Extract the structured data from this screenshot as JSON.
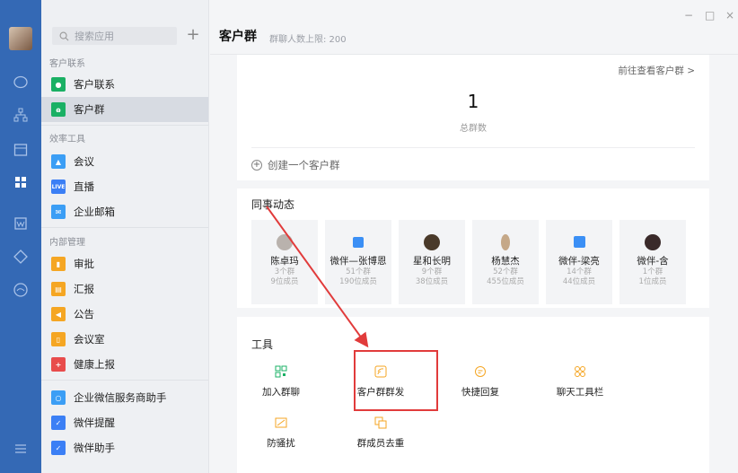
{
  "sidebar": {
    "search_placeholder": "搜索应用",
    "plus": "+",
    "sections": [
      "客户联系",
      "效率工具",
      "内部管理"
    ],
    "items": [
      {
        "label": "客户联系",
        "color": "#1ab064",
        "icon": "chat-icon"
      },
      {
        "label": "客户群",
        "color": "#1ab064",
        "icon": "group-icon"
      },
      {
        "label": "会议",
        "color": "#3b9ef5",
        "icon": "meeting-icon"
      },
      {
        "label": "直播",
        "color": "#3b7ff5",
        "icon": "live-icon",
        "badge": "LIVE"
      },
      {
        "label": "企业邮箱",
        "color": "#3b9ef5",
        "icon": "mail-icon"
      },
      {
        "label": "审批",
        "color": "#f5a623",
        "icon": "approval-icon"
      },
      {
        "label": "汇报",
        "color": "#f5a623",
        "icon": "report-icon"
      },
      {
        "label": "公告",
        "color": "#f5a623",
        "icon": "announcement-icon"
      },
      {
        "label": "会议室",
        "color": "#f5a623",
        "icon": "meeting-room-icon"
      },
      {
        "label": "健康上报",
        "color": "#e84c4c",
        "icon": "health-icon"
      },
      {
        "label": "企业微信服务商助手",
        "color": "#3b9ef5",
        "icon": "service-icon"
      },
      {
        "label": "微伴提醒",
        "color": "#3b7ff5",
        "icon": "remind-icon"
      },
      {
        "label": "微伴助手",
        "color": "#3b7ff5",
        "icon": "assistant-icon"
      }
    ]
  },
  "header": {
    "title": "客户群",
    "subtitle": "群聊人数上限: 200"
  },
  "summary": {
    "goto": "前往查看客户群 >",
    "count": "1",
    "count_label": "总群数",
    "create": "创建一个客户群"
  },
  "colleagues": {
    "title": "同事动态",
    "people": [
      {
        "name": "陈卓玛",
        "groups": "3个群",
        "members": "9位成员",
        "avatar_color": "#b9b2ad"
      },
      {
        "name": "微伴—张博恩",
        "groups": "51个群",
        "members": "190位成员",
        "avatar_color": "#3b8ff5"
      },
      {
        "name": "星和长明",
        "groups": "9个群",
        "members": "38位成员",
        "avatar_color": "#4a3a2a"
      },
      {
        "name": "杨慧杰",
        "groups": "52个群",
        "members": "455位成员",
        "avatar_color": "#c5a888"
      },
      {
        "name": "微伴-梁亮",
        "groups": "14个群",
        "members": "44位成员",
        "avatar_color": "#3b8ff5"
      },
      {
        "name": "微伴-含",
        "groups": "1个群",
        "members": "1位成员",
        "avatar_color": "#3a2a2a"
      }
    ]
  },
  "tools": {
    "title": "工具",
    "items": [
      {
        "label": "加入群聊",
        "icon": "qr-code-icon",
        "color": "#1ab064"
      },
      {
        "label": "客户群群发",
        "icon": "broadcast-icon",
        "color": "#f5a623"
      },
      {
        "label": "快捷回复",
        "icon": "quick-reply-icon",
        "color": "#f5a623"
      },
      {
        "label": "聊天工具栏",
        "icon": "toolbar-icon",
        "color": "#f5a623"
      },
      {
        "label": "防骚扰",
        "icon": "anti-harass-icon",
        "color": "#f5a623"
      },
      {
        "label": "群成员去重",
        "icon": "dedupe-icon",
        "color": "#f5a623"
      }
    ]
  },
  "window": {
    "minimize": "−",
    "maximize": "□",
    "close": "×"
  }
}
